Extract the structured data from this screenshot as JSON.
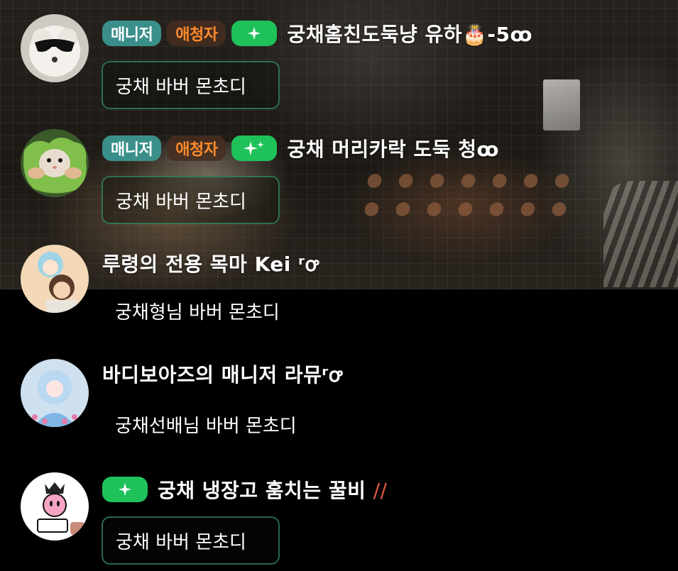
{
  "colors": {
    "manager_badge": "#3a8f8a",
    "fan_badge_text": "#ff8a2a",
    "star_badge": "#1fc25a",
    "bubble_border": "#348c64"
  },
  "messages": [
    {
      "avatar": "white-puppy-sunglasses",
      "badges": {
        "manager": "매니저",
        "fan": "애청자",
        "star_icon": "sparkle-icon"
      },
      "nickname": "궁채홈친도둑냥 유하🎂-5ꝏ",
      "text": "궁채 바버 몬초디"
    },
    {
      "avatar": "hamster-lettuce",
      "badges": {
        "manager": "매니저",
        "fan": "애청자",
        "star_icon": "double-sparkle-icon"
      },
      "nickname": "궁채 머리카락 도둑 청ꝏ",
      "text": "궁채 바버 몬초디"
    },
    {
      "avatar": "anime-couple",
      "nickname": "루령의 전용 목마 Kei ʳꝍ",
      "text": "궁채형님 바버 몬초디"
    },
    {
      "avatar": "anime-blue-fantasy",
      "nickname": "바디보아즈의 매니저 라뮤ʳꝍ",
      "text": "궁채선배님 바버 몬초디"
    },
    {
      "avatar": "kirby-sticker",
      "badges": {
        "star_icon": "sparkle-icon"
      },
      "nickname": "궁채 냉장고 훔치는 꿀비",
      "nickname_suffix": "//",
      "text": "궁채 바버 몬초디"
    }
  ]
}
